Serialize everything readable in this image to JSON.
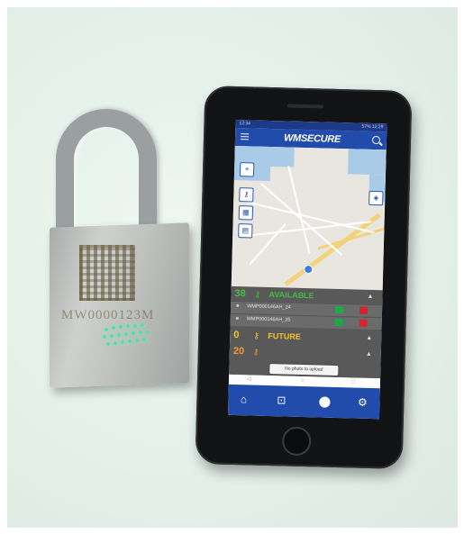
{
  "lock": {
    "serial": "MW0000123M"
  },
  "app": {
    "status_left": "12:34",
    "status_right": "57% 12:29",
    "title": "WMSECURE"
  },
  "statuses": [
    {
      "count": "38",
      "label": "AVAILABLE",
      "color": "#3fbf3f"
    },
    {
      "count": "0",
      "label": "FUTURE",
      "color": "#f1c23c"
    },
    {
      "count": "20",
      "label": "",
      "color": "#f09a30"
    }
  ],
  "locks": [
    {
      "id": "WMP000146AH_24"
    },
    {
      "id": "WMP000146AH_25"
    }
  ],
  "toast": "No photo to upload",
  "icons": {
    "menu": "hamburger-icon",
    "search": "search-icon",
    "tabs": [
      "home-icon",
      "lock-icon",
      "map-pin-icon",
      "gear-icon"
    ],
    "map_buttons": [
      "target-icon",
      "key-icon",
      "calendar-icon",
      "clipboard-icon",
      "layers-icon"
    ]
  }
}
